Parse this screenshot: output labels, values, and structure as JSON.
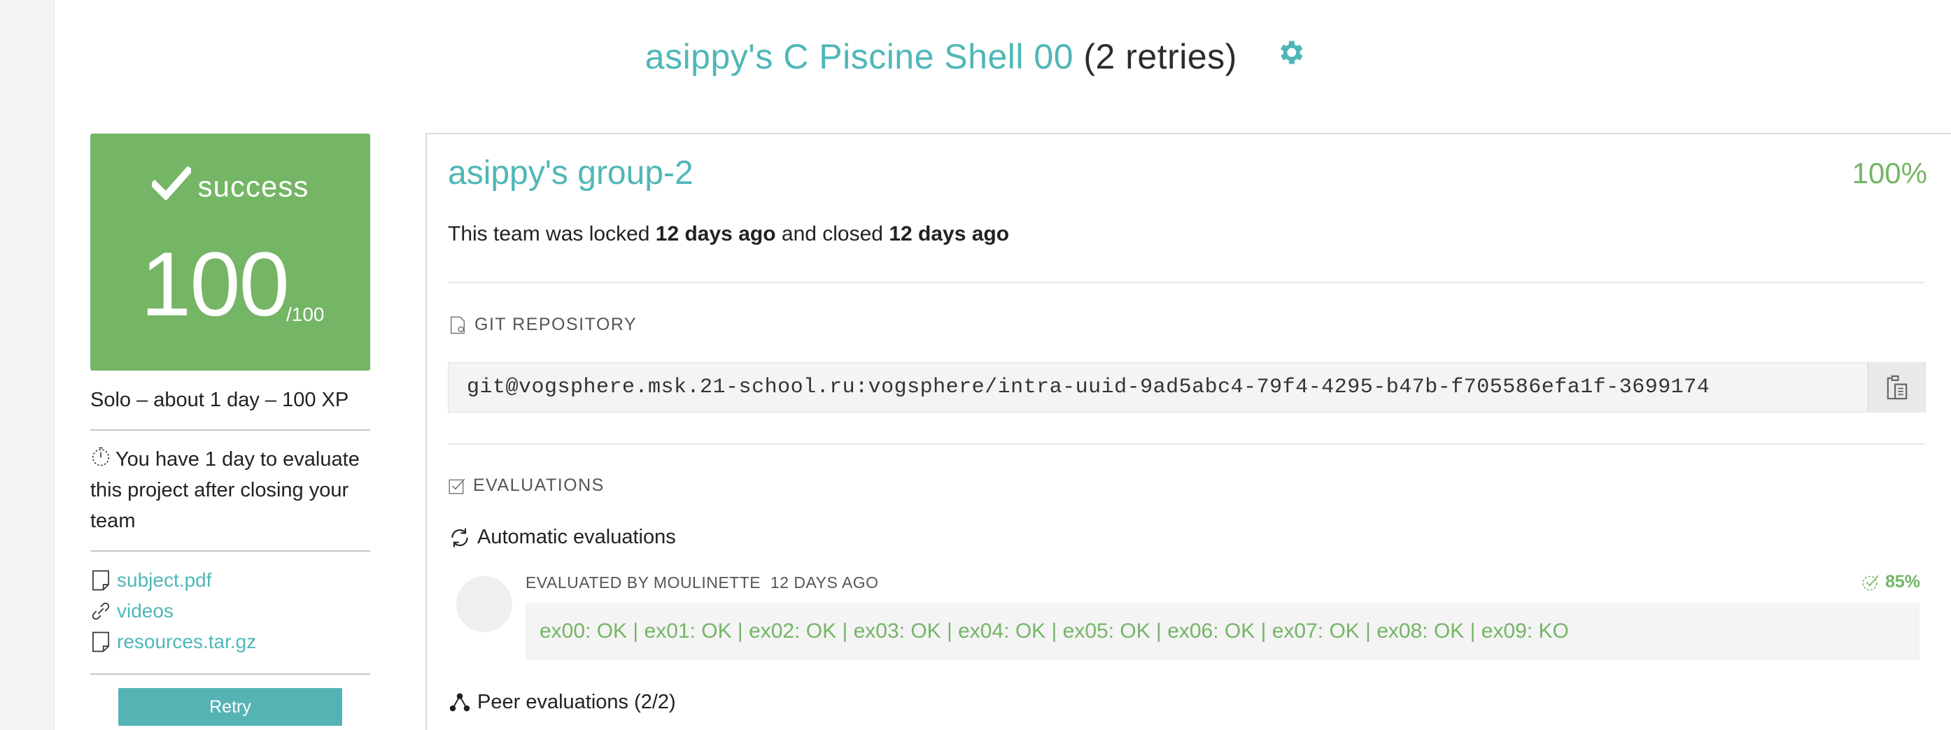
{
  "header": {
    "title_accent": "asippy's C Piscine Shell 00",
    "title_rest": " (2 retries)",
    "settings_icon": "gear-icon"
  },
  "result": {
    "status": "success",
    "score": "100",
    "max": "/100",
    "color": "#74b566"
  },
  "project_meta": "Solo – about 1 day – 100 XP",
  "eval_note": "You have 1 day to evaluate this project after closing your team",
  "files": [
    {
      "icon": "document-icon",
      "label": "subject.pdf"
    },
    {
      "icon": "link-icon",
      "label": "videos"
    },
    {
      "icon": "document-icon",
      "label": "resources.tar.gz"
    }
  ],
  "retry_label": "Retry",
  "team": {
    "name": "asippy's group-2",
    "percent": "100%",
    "lock_prefix": "This team was locked ",
    "locked_ago": "12 days ago",
    "lock_middle": " and closed ",
    "closed_ago": "12 days ago"
  },
  "git": {
    "label": "GIT REPOSITORY",
    "url": "git@vogsphere.msk.21-school.ru:vogsphere/intra-uuid-9ad5abc4-79f4-4295-b47b-f705586efa1f-3699174"
  },
  "evaluations": {
    "label": "EVALUATIONS",
    "automatic_title": "Automatic evaluations",
    "evaluator": "EVALUATED BY MOULINETTE",
    "evaluated_ago": "12 DAYS AGO",
    "score": "85%",
    "result": "ex00: OK | ex01: OK | ex02: OK | ex03: OK | ex04: OK | ex05: OK | ex06: OK | ex07: OK | ex08: OK | ex09: KO",
    "peer_title": "Peer evaluations (2/2)"
  },
  "colors": {
    "accent": "#4fb7b7",
    "success": "#74b566",
    "retry": "#56b3b4"
  }
}
